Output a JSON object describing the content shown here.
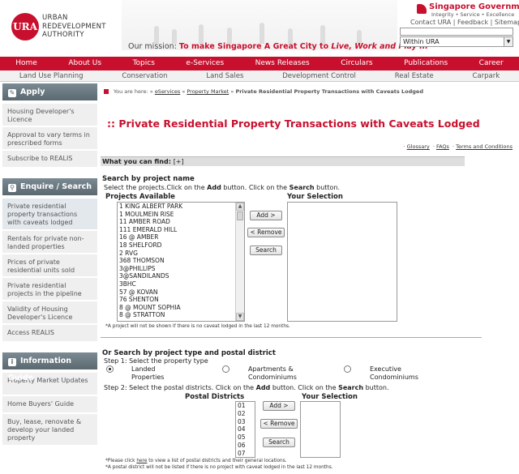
{
  "header": {
    "logo_mark": "URA",
    "org_lines": [
      "URBAN",
      "REDEVELOPMENT",
      "AUTHORITY"
    ],
    "mission_prefix": "Our mission: ",
    "mission_red": "To make Singapore A Great City to ",
    "mission_italic": "Live, Work and Play In",
    "gov_title": "Singapore Government",
    "gov_tagline": "Integrity • Service • Excellence",
    "top_links": "Contact URA | Feedback | Sitemap",
    "search_value": "",
    "scope_value": "Within URA"
  },
  "main_nav": [
    "Home",
    "About Us",
    "Topics",
    "e-Services",
    "News Releases",
    "Circulars",
    "Publications",
    "Career"
  ],
  "sub_nav": [
    "Land Use Planning",
    "Conservation",
    "Land Sales",
    "Development Control",
    "Real Estate",
    "Carpark"
  ],
  "sidebar": {
    "apply": {
      "title": "Apply",
      "items": [
        "Housing Developer's Licence",
        "Approval to vary terms in prescribed forms",
        "Subscribe to REALIS"
      ]
    },
    "enquire": {
      "title": "Enquire / Search",
      "items": [
        "Private residential property transactions with caveats lodged",
        "Rentals for private non-landed properties",
        "Prices of private residential units sold",
        "Private residential projects in the pipeline",
        "Validity of Housing Developer's Licence",
        "Access REALIS"
      ]
    },
    "info": {
      "title": "Information Guide",
      "items": [
        "Property Market Updates",
        "Home Buyers' Guide",
        "Buy, lease, renovate & develop your landed property"
      ]
    }
  },
  "breadcrumb": {
    "prefix": "You are here: »",
    "links": [
      "eServices",
      "Property Market"
    ],
    "current": "Private Residential Property Transactions with Caveats Lodged",
    "sep": "»"
  },
  "page_title": ":: Private Residential Property Transactions with Caveats Lodged",
  "help_links": [
    "Glossary",
    "FAQs",
    "Terms and Conditions"
  ],
  "find_bar": {
    "label": "What you can find:",
    "toggle": "[+]"
  },
  "by_name": {
    "title": "Search by project name",
    "instr_a": "Select the projects.Click on the ",
    "instr_add": "Add",
    "instr_b": " button. Click on the ",
    "instr_search": "Search",
    "instr_c": " button.",
    "projects_label": "Projects Available",
    "selection_label": "Your Selection",
    "projects": [
      "1 KING ALBERT PARK",
      "1 MOULMEIN RISE",
      "11 AMBER ROAD",
      "111 EMERALD HILL",
      "16 @ AMBER",
      "18 SHELFORD",
      "2 RVG",
      "368 THOMSON",
      "3@PHILLIPS",
      "3@SANDILANDS",
      "3BHC",
      "57 @ KOVAN",
      "76 SHENTON",
      "8 @ MOUNT SOPHIA",
      "8 @ STRATTON"
    ],
    "add_btn": "Add >",
    "remove_btn": "< Remove",
    "search_btn": "Search",
    "note": "*A project will not be shown if there is no caveat lodged in the last 12 months."
  },
  "by_type": {
    "title": "Or Search by project type and postal district",
    "step1": "Step 1: Select the property type",
    "types": [
      "Landed Properties",
      "Apartments & Condominiums",
      "Executive Condominiums"
    ],
    "step2_a": "Step 2: Select the postal districts. Click on the ",
    "step2_add": "Add",
    "step2_b": " button. Click on the ",
    "step2_search": "Search",
    "step2_c": " button.",
    "districts_label": "Postal Districts",
    "selection_label": "Your Selection",
    "districts": [
      "01",
      "02",
      "03",
      "04",
      "05",
      "06",
      "07"
    ],
    "add_btn": "Add >",
    "remove_btn": "< Remove",
    "search_btn": "Search",
    "note1_a": "*Please click ",
    "note1_link": "here",
    "note1_b": " to view a list of postal districts and their general locations.",
    "note2": "*A postal district will not be listed if there is no project with caveat lodged in the last 12 months."
  }
}
